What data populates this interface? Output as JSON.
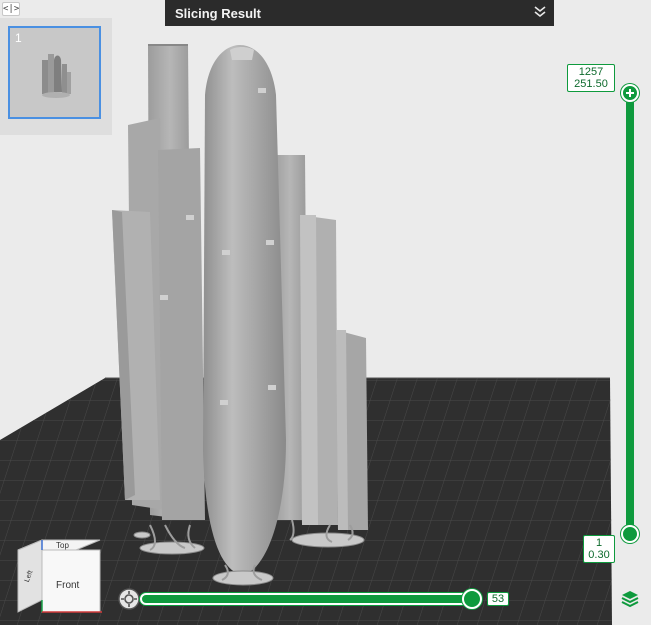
{
  "panel_toggle": {
    "icon": "collapse-icon",
    "glyph": "<|>"
  },
  "plates": [
    {
      "index": "1",
      "selected": true
    }
  ],
  "header": {
    "title": "Slicing Result",
    "toggle_icon": "double-chevron-down-icon"
  },
  "layer_slider": {
    "top_layer": "1257",
    "top_height": "251.50",
    "bottom_layer": "1",
    "bottom_height": "0.30",
    "accent": "#0e9a3d"
  },
  "move_slider": {
    "value": "53",
    "settings_icon": "gear-icon"
  },
  "view_cube": {
    "top": "Top",
    "front": "Front",
    "left": "Left"
  },
  "layers_icon": "layers-icon",
  "colors": {
    "background": "#ebebeb",
    "bed": "#2f2f2f",
    "model": "#a9a9a9",
    "selection": "#4a90e2"
  }
}
